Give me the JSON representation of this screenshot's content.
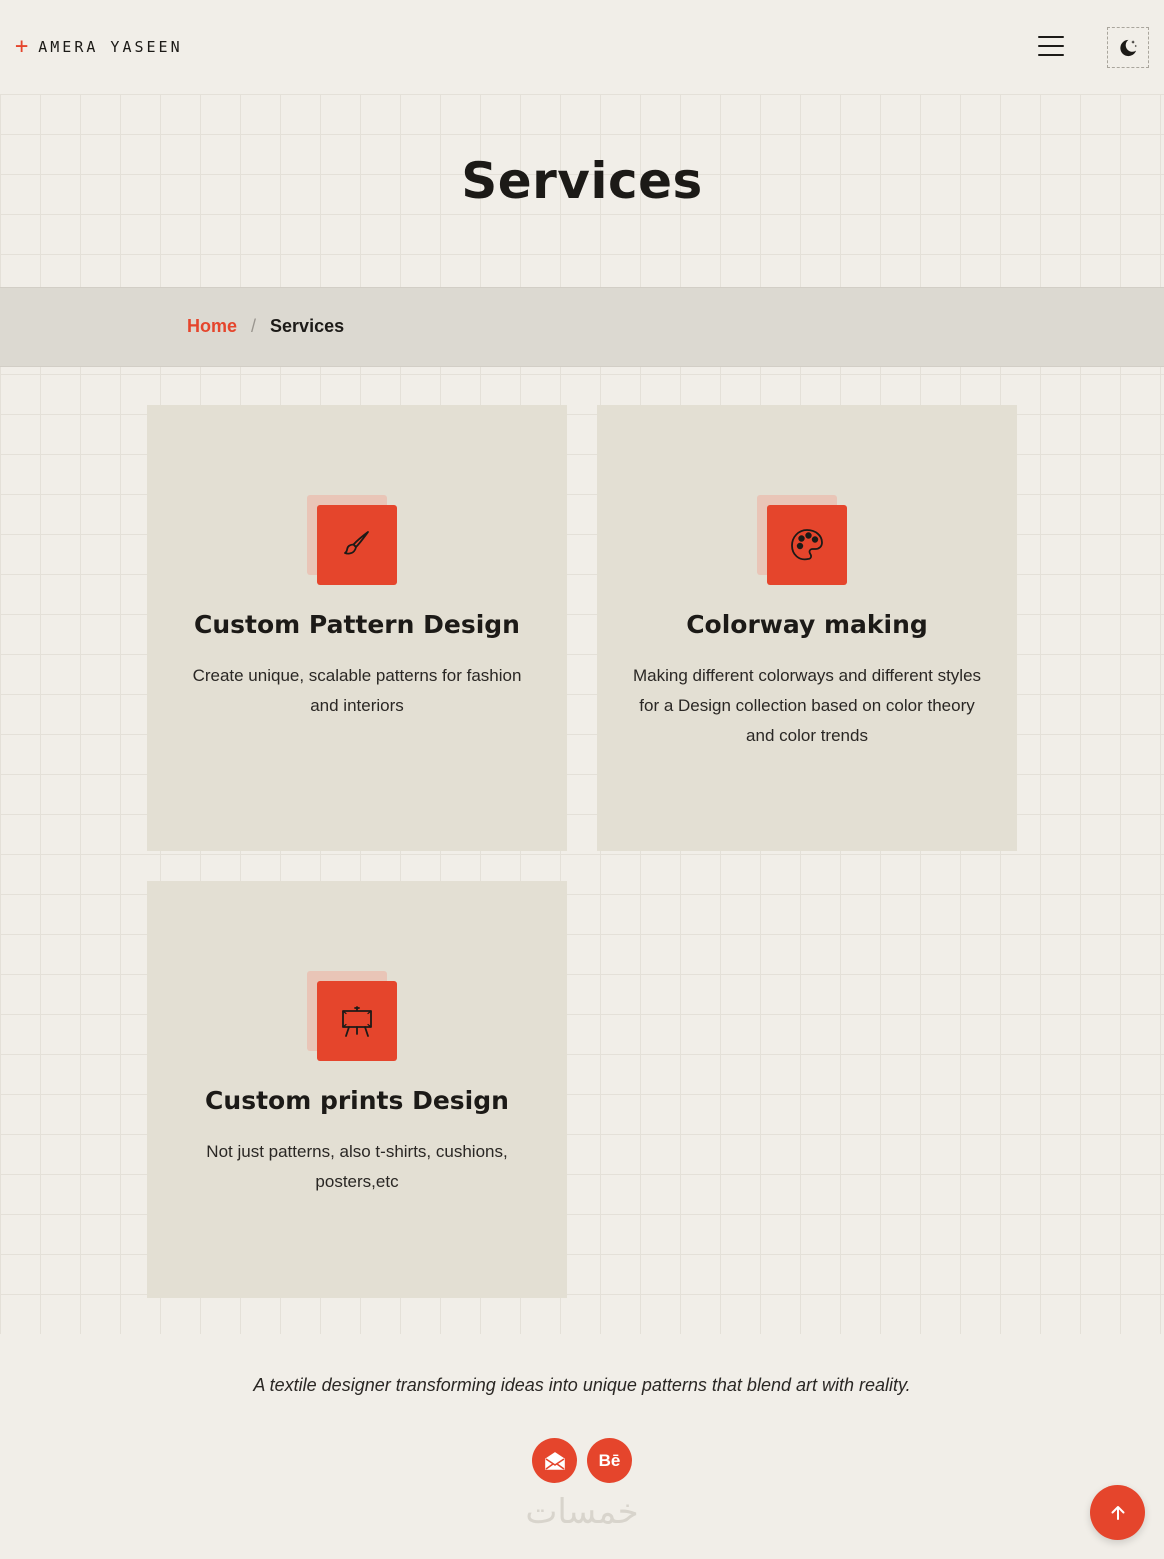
{
  "header": {
    "brand_plus": "+",
    "brand_name": "AMERA YASEEN",
    "menu_icon": "hamburger-menu-icon",
    "theme_icon": "moon-stars-icon"
  },
  "hero": {
    "title": "Services"
  },
  "breadcrumb": {
    "home": "Home",
    "separator": "/",
    "current": "Services"
  },
  "services": [
    {
      "icon": "paintbrush-icon",
      "title": "Custom Pattern Design",
      "description": "Create unique, scalable patterns for fashion and interiors"
    },
    {
      "icon": "palette-icon",
      "title": "Colorway making",
      "description": "Making different colorways and different styles for a Design collection based on color theory and color trends"
    },
    {
      "icon": "easel-icon",
      "title": "Custom prints Design",
      "description": "Not just patterns, also t-shirts, cushions, posters,etc"
    }
  ],
  "footer": {
    "tagline": "A textile designer transforming ideas into unique patterns that blend art with reality.",
    "social": [
      {
        "icon": "mail-icon",
        "label": ""
      },
      {
        "icon": "behance-icon",
        "label": "Bē"
      }
    ],
    "watermark": "خمسات",
    "scroll_top_icon": "arrow-up-icon"
  },
  "colors": {
    "accent": "#e5452c",
    "background": "#f1eee8",
    "card": "#e3dfd3",
    "band": "#dcd9d1",
    "text": "#1c1a17"
  }
}
